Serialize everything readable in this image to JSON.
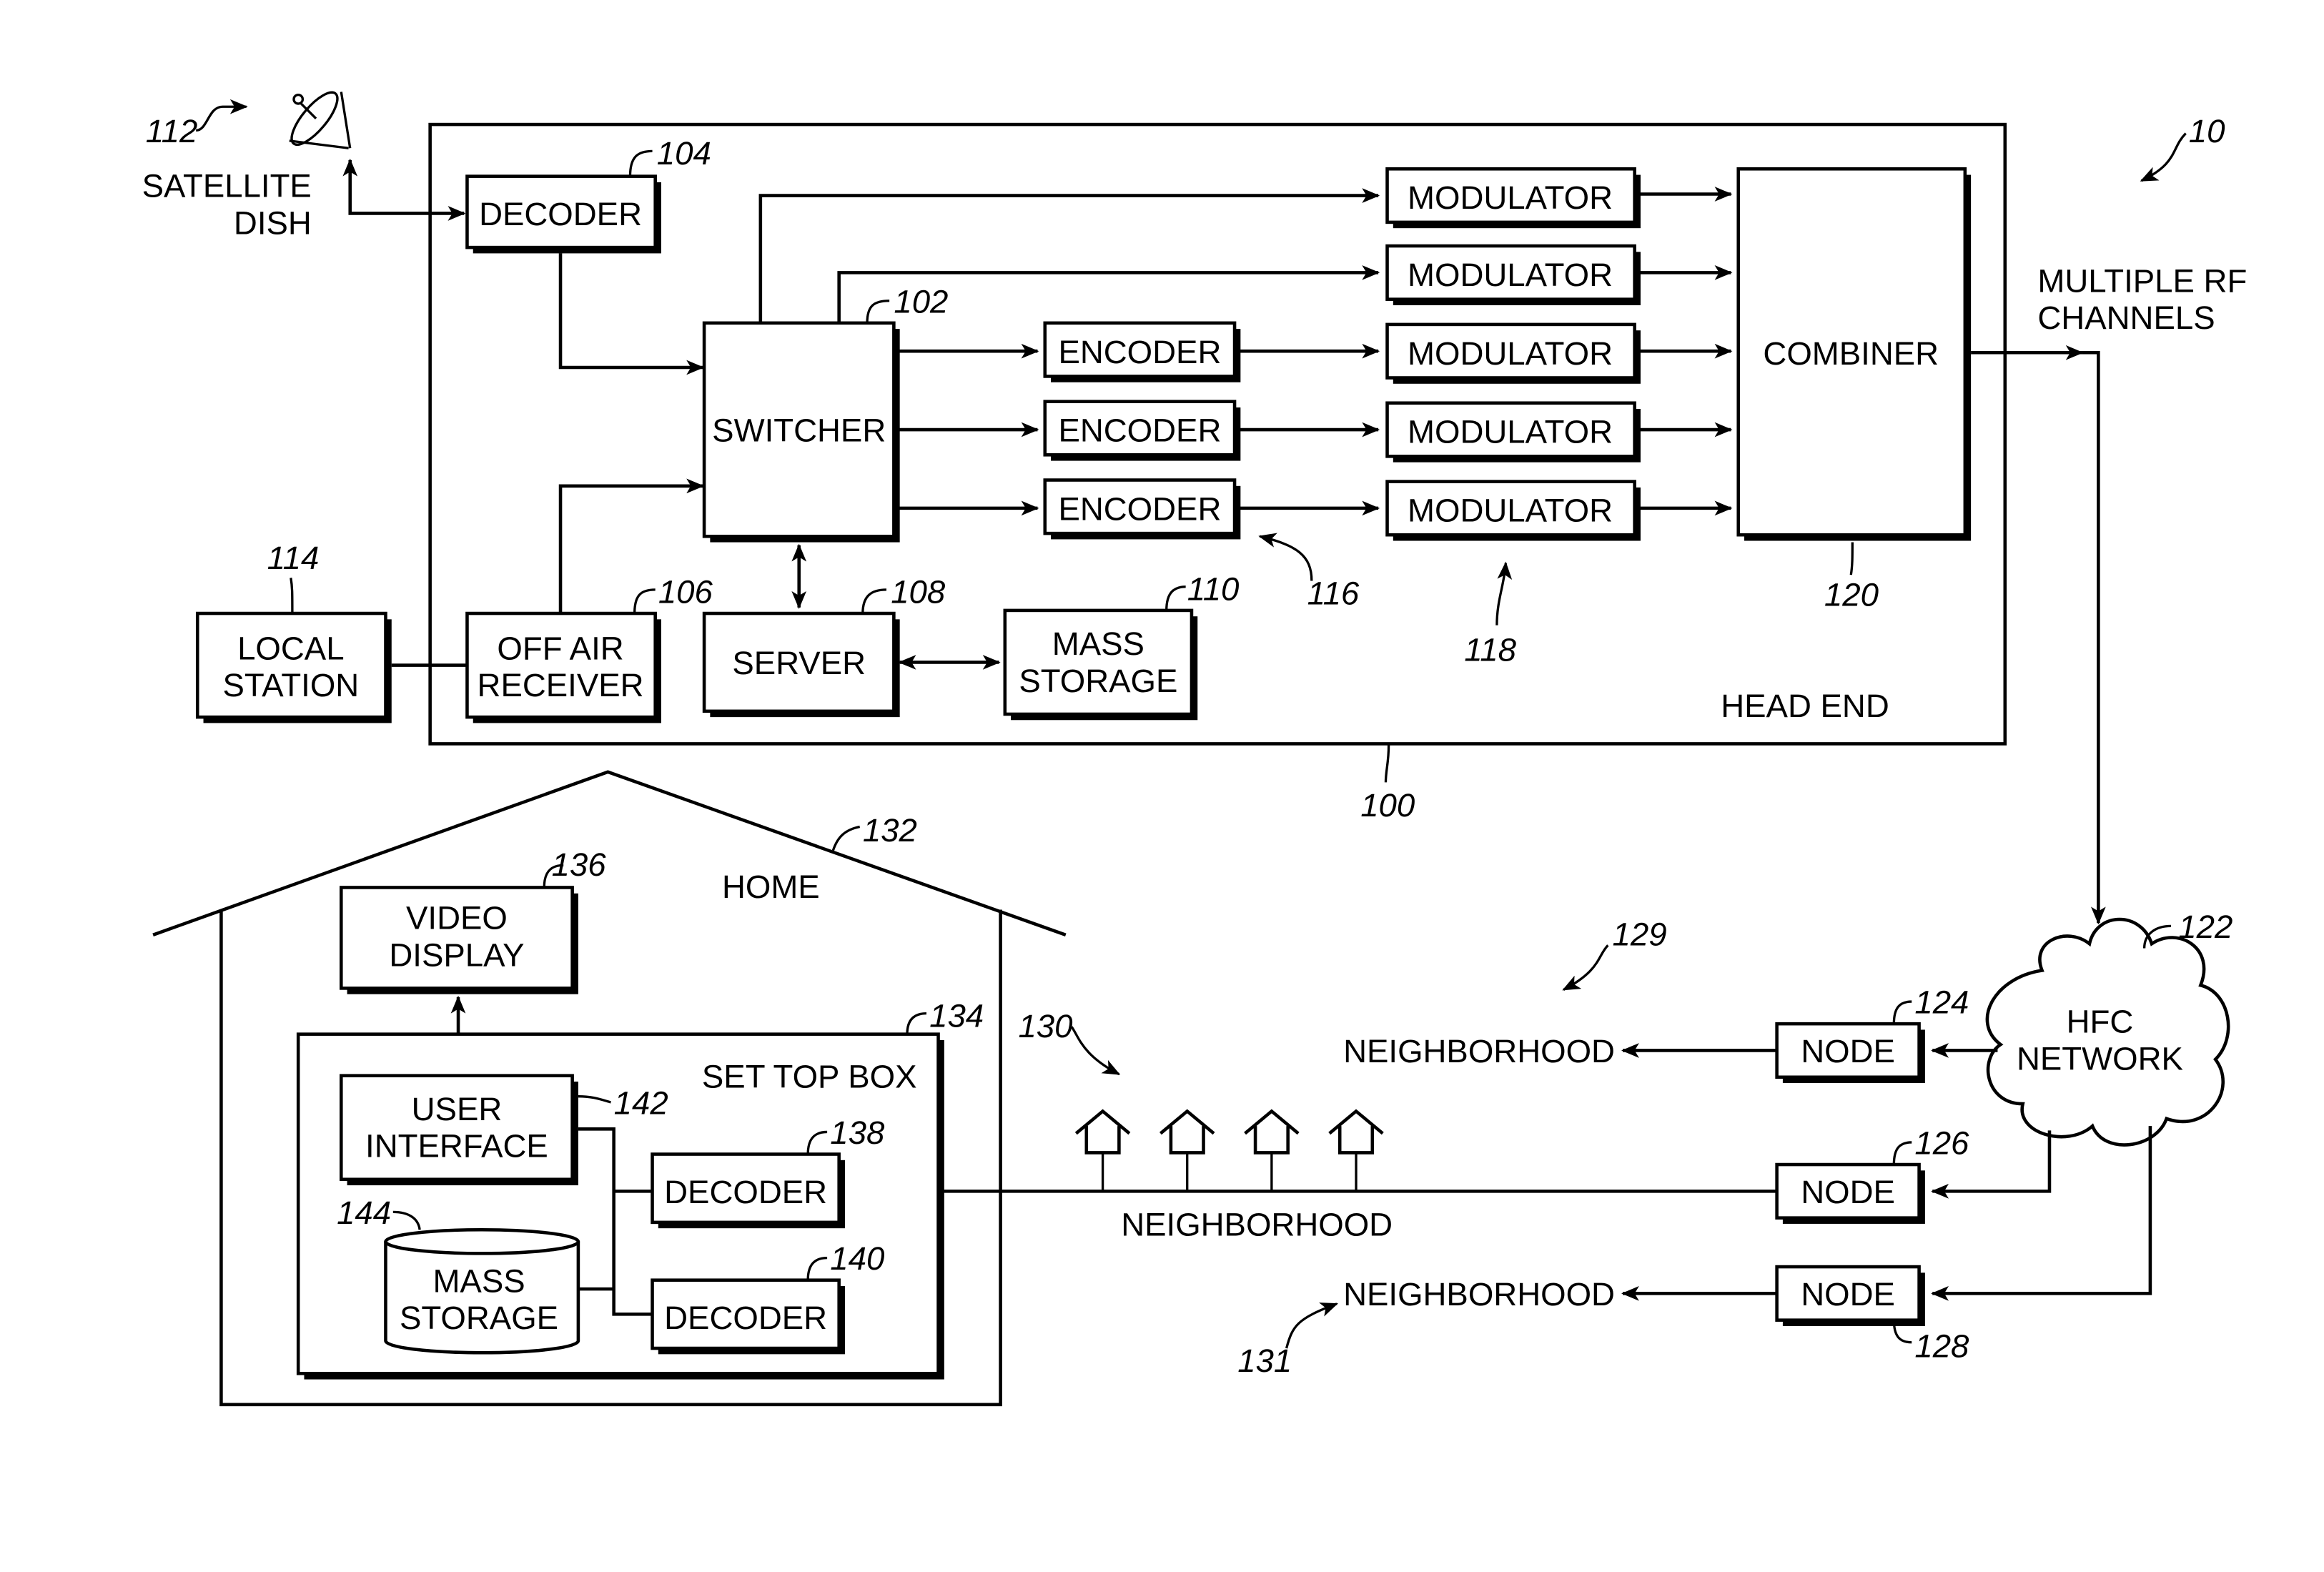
{
  "figure_ref": "10",
  "head_end": {
    "ref": "100",
    "label": "HEAD END",
    "decoder": {
      "ref": "104",
      "label": "DECODER"
    },
    "switcher": {
      "ref": "102",
      "label": "SWITCHER"
    },
    "encoders": {
      "ref": "116",
      "items": [
        "ENCODER",
        "ENCODER",
        "ENCODER"
      ]
    },
    "modulators": {
      "ref": "118",
      "items": [
        "MODULATOR",
        "MODULATOR",
        "MODULATOR",
        "MODULATOR",
        "MODULATOR"
      ]
    },
    "combiner": {
      "ref": "120",
      "label": "COMBINER"
    },
    "off_air_receiver": {
      "ref": "106",
      "line1": "OFF AIR",
      "line2": "RECEIVER"
    },
    "server": {
      "ref": "108",
      "label": "SERVER"
    },
    "mass_storage": {
      "ref": "110",
      "line1": "MASS",
      "line2": "STORAGE"
    }
  },
  "satellite_dish": {
    "ref": "112",
    "line1": "SATELLITE",
    "line2": "DISH"
  },
  "local_station": {
    "ref": "114",
    "line1": "LOCAL",
    "line2": "STATION"
  },
  "rf_output": {
    "line1": "MULTIPLE RF",
    "line2": "CHANNELS"
  },
  "hfc_network": {
    "ref": "122",
    "line1": "HFC",
    "line2": "NETWORK"
  },
  "nodes": [
    {
      "ref": "124",
      "label": "NODE"
    },
    {
      "ref": "126",
      "label": "NODE"
    },
    {
      "ref": "128",
      "label": "NODE"
    }
  ],
  "neighborhoods": [
    {
      "ref": "129",
      "label": "NEIGHBORHOOD"
    },
    {
      "ref": "130",
      "label": "NEIGHBORHOOD"
    },
    {
      "ref": "131",
      "label": "NEIGHBORHOOD"
    }
  ],
  "home": {
    "ref": "132",
    "label": "HOME",
    "video_display": {
      "ref": "136",
      "line1": "VIDEO",
      "line2": "DISPLAY"
    },
    "set_top_box": {
      "ref": "134",
      "label": "SET TOP BOX",
      "user_interface": {
        "ref": "142",
        "line1": "USER",
        "line2": "INTERFACE"
      },
      "mass_storage": {
        "ref": "144",
        "line1": "MASS",
        "line2": "STORAGE"
      },
      "decoder_a": {
        "ref": "138",
        "label": "DECODER"
      },
      "decoder_b": {
        "ref": "140",
        "label": "DECODER"
      }
    }
  }
}
